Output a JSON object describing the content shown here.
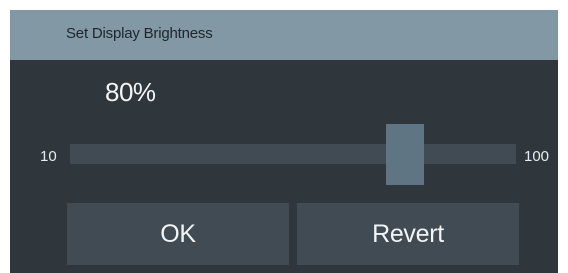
{
  "dialog": {
    "title": "Set Display Brightness"
  },
  "brightness": {
    "value_label": "80%",
    "value_percent": 80,
    "min_label": "10",
    "max_label": "100"
  },
  "buttons": {
    "ok_label": "OK",
    "revert_label": "Revert"
  },
  "colors": {
    "title_bar": "#8298a5",
    "panel_background": "#2f373d",
    "track": "#404b53",
    "thumb": "#5f7584",
    "button": "#404b53",
    "text": "#f2f4f5"
  }
}
